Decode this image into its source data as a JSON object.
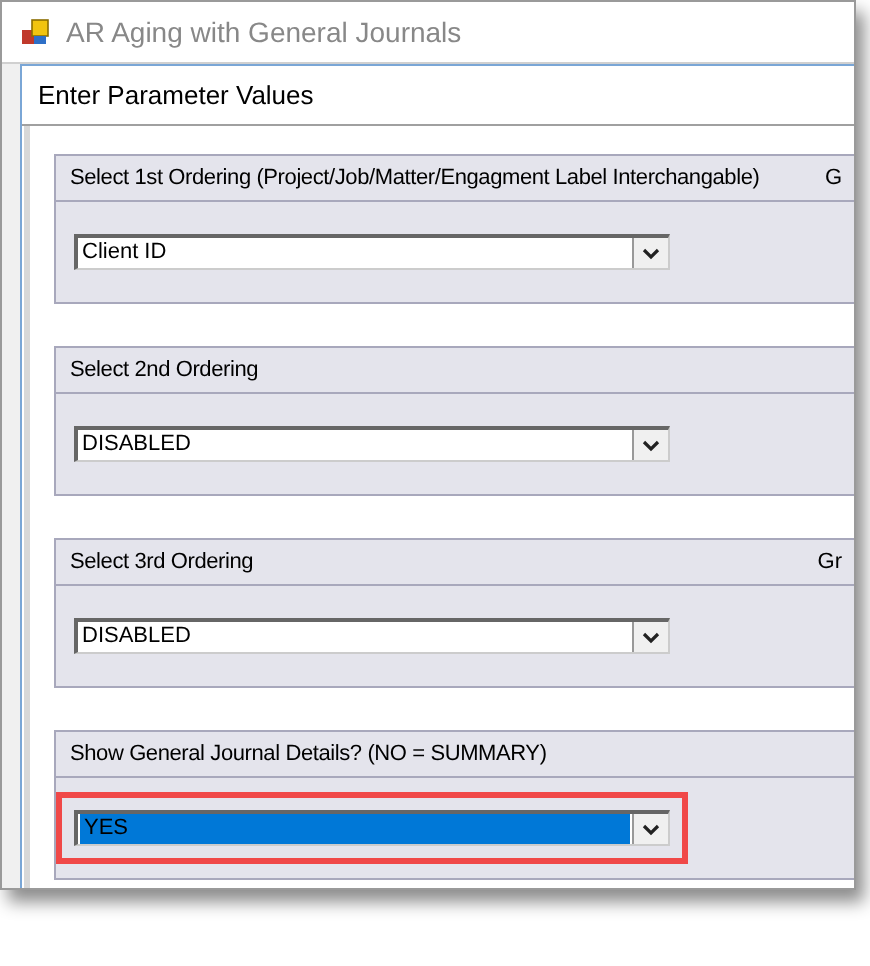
{
  "window": {
    "title": "AR Aging with General Journals"
  },
  "dialog": {
    "title": "Enter Parameter Values"
  },
  "parameters": [
    {
      "label": "Select 1st Ordering (Project/Job/Matter/Engagment Label Interchangable)",
      "side_label": "G",
      "value": "Client ID",
      "selected": false,
      "outlined": false
    },
    {
      "label": "Select 2nd Ordering",
      "value": "DISABLED",
      "selected": false,
      "outlined": false
    },
    {
      "label": "Select 3rd Ordering",
      "side_label": "Gr",
      "value": "DISABLED",
      "selected": false,
      "outlined": false
    },
    {
      "label": "Show General Journal Details? (NO = SUMMARY)",
      "value": "YES",
      "selected": true,
      "outlined": true
    }
  ]
}
